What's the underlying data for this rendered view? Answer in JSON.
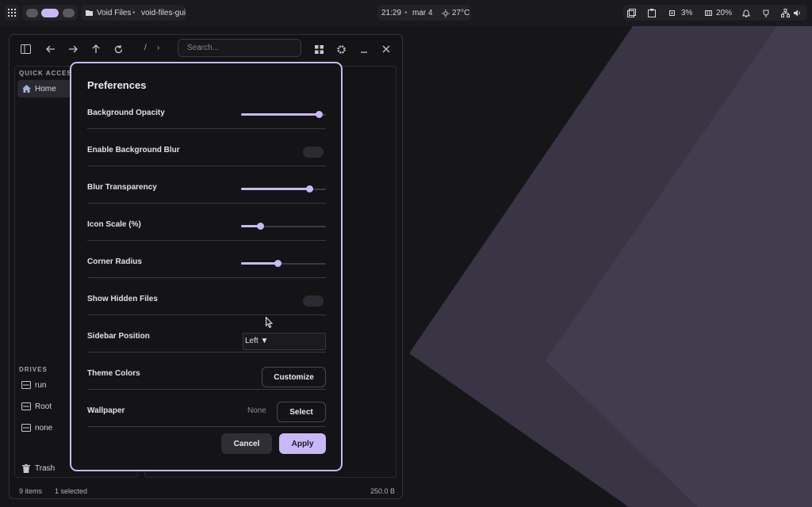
{
  "topbar": {
    "window_title": "Void Files",
    "separator": "•",
    "app_id": "void-files-gui",
    "time": "21:29",
    "date_separator": "•",
    "date": "mar 4",
    "weather": "27°C",
    "cpu": "3%",
    "memory": "20%"
  },
  "file_manager": {
    "path_root": "/",
    "path_chevron": "›",
    "search_placeholder": "Search...",
    "quick_access_label": "QUICK ACCESS",
    "quick_access": [
      {
        "label": "Home"
      }
    ],
    "drives_label": "DRIVES",
    "drives": [
      {
        "label": "run"
      },
      {
        "label": "Root"
      },
      {
        "label": "none"
      }
    ],
    "trash_label": "Trash",
    "status": {
      "items": "9 items",
      "selected": "1 selected",
      "size": "250.0 B"
    }
  },
  "preferences": {
    "title": "Preferences",
    "background_opacity": {
      "label": "Background Opacity",
      "value": 0.92
    },
    "enable_blur": {
      "label": "Enable Background Blur",
      "on": false
    },
    "blur_transparency": {
      "label": "Blur Transparency",
      "value": 0.8
    },
    "icon_scale": {
      "label": "Icon Scale (%)",
      "value": 0.22
    },
    "corner_radius": {
      "label": "Corner Radius",
      "value": 0.43
    },
    "show_hidden": {
      "label": "Show Hidden Files",
      "on": false
    },
    "sidebar_position": {
      "label": "Sidebar Position",
      "value": "Left",
      "arrow": "▼"
    },
    "theme_colors": {
      "label": "Theme Colors",
      "button": "Customize"
    },
    "wallpaper": {
      "label": "Wallpaper",
      "value": "None",
      "button": "Select"
    },
    "cancel": "Cancel",
    "apply": "Apply"
  },
  "colors": {
    "accent": "#c9b8f5",
    "background": "#161518",
    "wallpaper_panel": "#3a3545"
  }
}
